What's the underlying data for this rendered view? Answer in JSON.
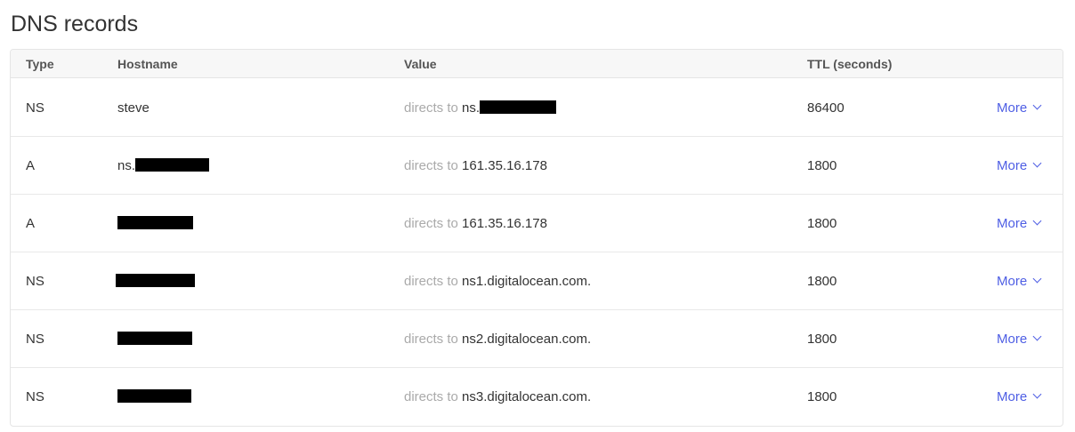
{
  "page": {
    "title": "DNS records"
  },
  "table": {
    "headers": {
      "type": "Type",
      "hostname": "Hostname",
      "value": "Value",
      "ttl": "TTL (seconds)"
    },
    "directs_label": "directs to",
    "more_label": "More",
    "rows": [
      {
        "type": "NS",
        "hostname": "steve",
        "hostname_redacted": false,
        "value": "ns.",
        "ttl": "86400"
      },
      {
        "type": "A",
        "hostname": "ns.",
        "hostname_redacted": true,
        "value": "161.35.16.178",
        "ttl": "1800"
      },
      {
        "type": "A",
        "hostname": "",
        "hostname_redacted": true,
        "value": "161.35.16.178",
        "ttl": "1800"
      },
      {
        "type": "NS",
        "hostname": "",
        "hostname_redacted": true,
        "value": "ns1.digitalocean.com.",
        "ttl": "1800"
      },
      {
        "type": "NS",
        "hostname": "",
        "hostname_redacted": true,
        "value": "ns2.digitalocean.com.",
        "ttl": "1800"
      },
      {
        "type": "NS",
        "hostname": "",
        "hostname_redacted": true,
        "value": "ns3.digitalocean.com.",
        "ttl": "1800"
      }
    ]
  },
  "colors": {
    "accent": "#4e5ee4",
    "muted": "#aaaaaa",
    "redaction": "#000000"
  },
  "icons": {
    "more": "chevron-down-icon"
  }
}
